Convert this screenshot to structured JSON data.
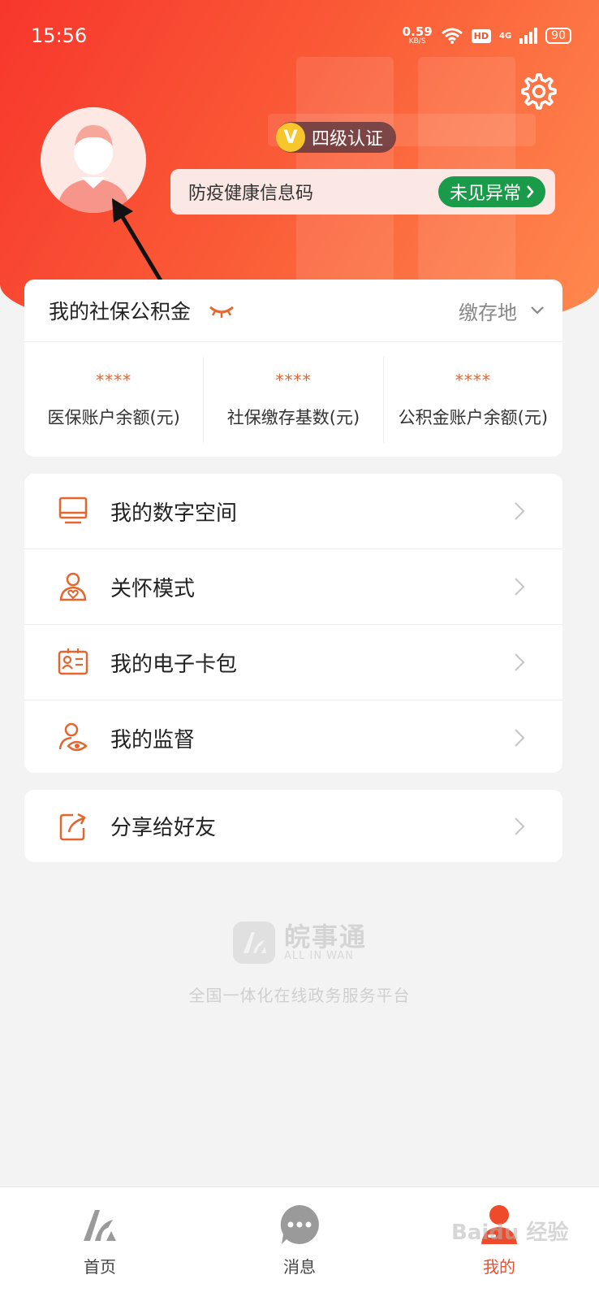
{
  "status_bar": {
    "time": "15:56",
    "net_speed": "0.59",
    "net_unit": "KB/S",
    "hd": "HD",
    "signal": "4G",
    "battery": "90"
  },
  "header": {
    "settings_icon": "gear-icon",
    "avatar_icon": "user-avatar-icon",
    "certification_badge": "V",
    "certification_label": "四级认证",
    "health_code_label": "防疫健康信息码",
    "health_code_status": "未见异常",
    "health_status_color": "#1a9b4a"
  },
  "social_security": {
    "title": "我的社保公积金",
    "location_label": "缴存地",
    "columns": [
      {
        "value": "****",
        "label": "医保账户余额(元)"
      },
      {
        "value": "****",
        "label": "社保缴存基数(元)"
      },
      {
        "value": "****",
        "label": "公积金账户余额(元)"
      }
    ]
  },
  "menu": [
    {
      "label": "我的数字空间",
      "icon": "monitor-icon"
    },
    {
      "label": "关怀模式",
      "icon": "care-mode-icon"
    },
    {
      "label": "我的电子卡包",
      "icon": "id-card-icon"
    },
    {
      "label": "我的监督",
      "icon": "supervision-icon"
    }
  ],
  "share": {
    "label": "分享给好友",
    "icon": "share-icon"
  },
  "brand": {
    "name": "皖事通",
    "english": "ALL IN WAN",
    "slogan": "全国一体化在线政务服务平台"
  },
  "tabbar": {
    "tabs": [
      {
        "label": "首页",
        "icon": "home-logo-icon"
      },
      {
        "label": "消息",
        "icon": "message-icon"
      },
      {
        "label": "我的",
        "icon": "profile-icon",
        "active": true
      }
    ]
  },
  "colors": {
    "accent": "#ef4b2a",
    "icon_orange": "#e5652d"
  }
}
